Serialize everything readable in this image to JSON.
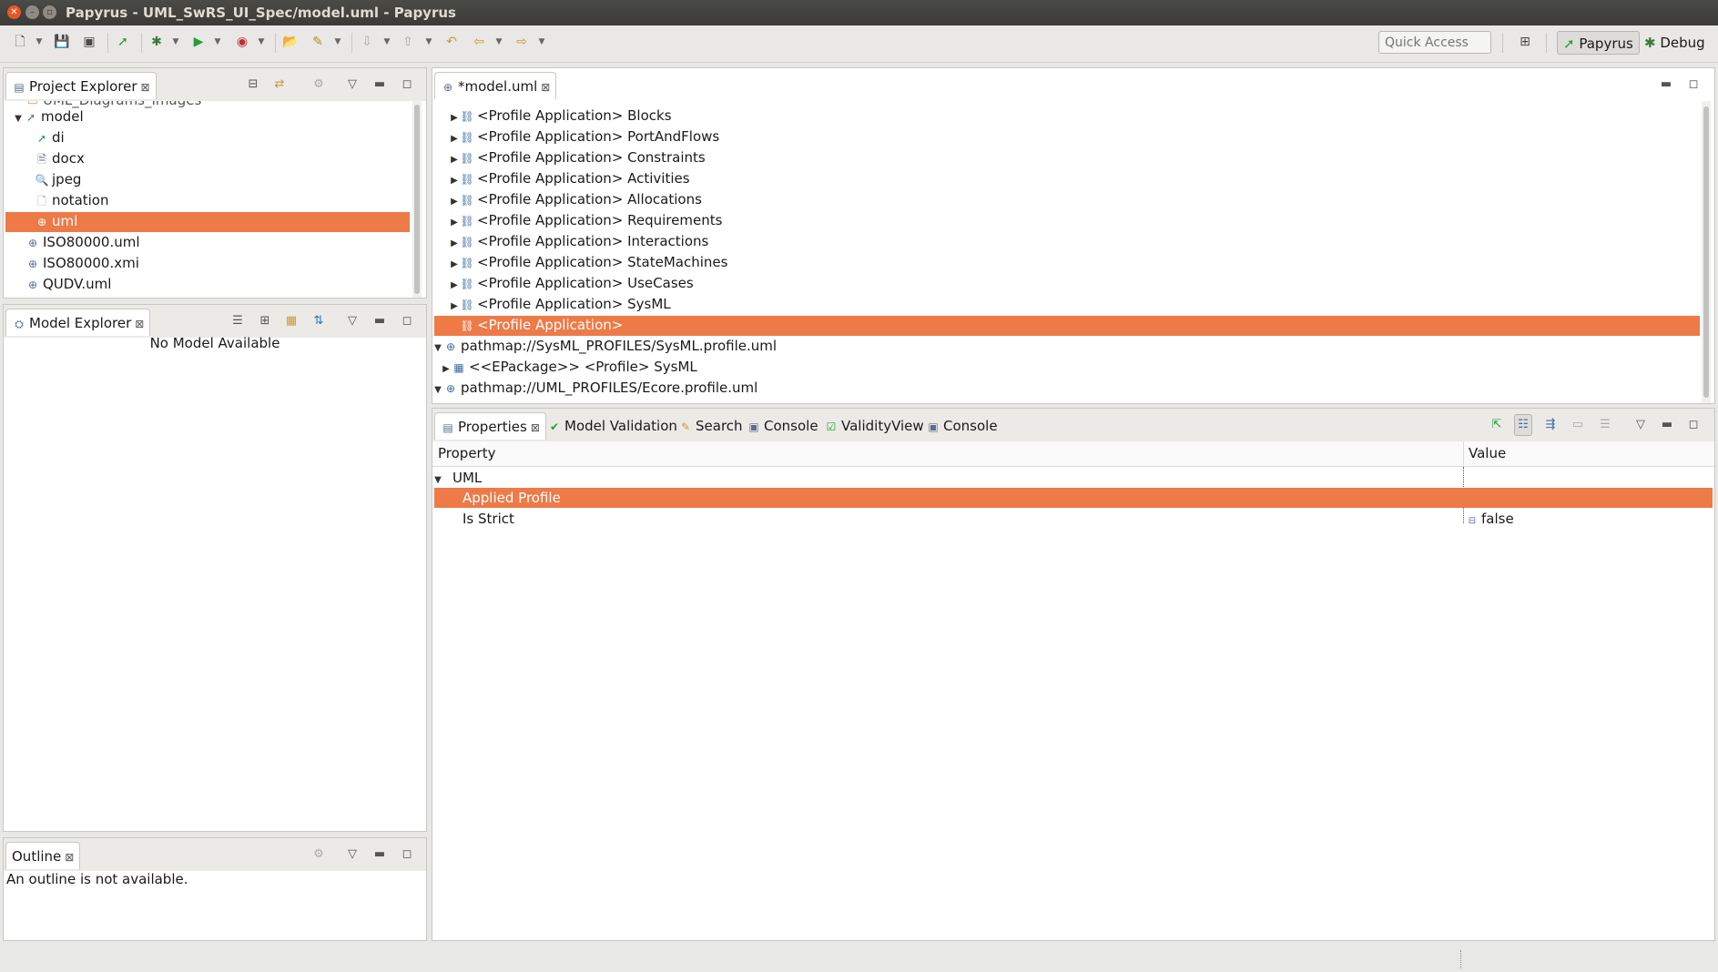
{
  "window": {
    "title": "Papyrus - UML_SwRS_UI_Spec/model.uml - Papyrus"
  },
  "toolbar": {
    "quick_access_placeholder": "Quick Access",
    "perspectives": [
      "Papyrus",
      "Debug"
    ]
  },
  "project_explorer": {
    "title": "Project Explorer",
    "truncated_top": "UML_Diagrams_Images",
    "items": [
      {
        "label": "model",
        "expanded": true
      },
      {
        "label": "di"
      },
      {
        "label": "docx"
      },
      {
        "label": "jpeg"
      },
      {
        "label": "notation"
      },
      {
        "label": "uml",
        "selected": true
      },
      {
        "label": "ISO80000.uml"
      },
      {
        "label": "ISO80000.xmi"
      },
      {
        "label": "QUDV.uml"
      }
    ]
  },
  "model_explorer": {
    "title": "Model Explorer",
    "empty_text": "No Model Available"
  },
  "outline": {
    "title": "Outline",
    "empty_text": "An outline is not available."
  },
  "editor": {
    "tab_label": "*model.uml",
    "rows": [
      {
        "label": "<Profile Application> Blocks"
      },
      {
        "label": "<Profile Application> PortAndFlows"
      },
      {
        "label": "<Profile Application> Constraints"
      },
      {
        "label": "<Profile Application> Activities"
      },
      {
        "label": "<Profile Application> Allocations"
      },
      {
        "label": "<Profile Application> Requirements"
      },
      {
        "label": "<Profile Application> Interactions"
      },
      {
        "label": "<Profile Application> StateMachines"
      },
      {
        "label": "<Profile Application> UseCases"
      },
      {
        "label": "<Profile Application> SysML"
      },
      {
        "label": "<Profile Application>",
        "selected": true
      },
      {
        "label": "pathmap://SysML_PROFILES/SysML.profile.uml"
      },
      {
        "label": "<<EPackage>> <Profile> SysML"
      },
      {
        "label": "pathmap://UML_PROFILES/Ecore.profile.uml"
      }
    ]
  },
  "bottom_tabs": [
    "Properties",
    "Model Validation",
    "Search",
    "Console",
    "ValidityView",
    "Console"
  ],
  "properties": {
    "col_property": "Property",
    "col_value": "Value",
    "group": "UML",
    "rows": [
      {
        "property": "Applied Profile",
        "value": "",
        "selected": true
      },
      {
        "property": "Is Strict",
        "value": "false"
      }
    ]
  },
  "colors": {
    "selection": "#ee7a48",
    "titlebar": "#3c3b37"
  }
}
